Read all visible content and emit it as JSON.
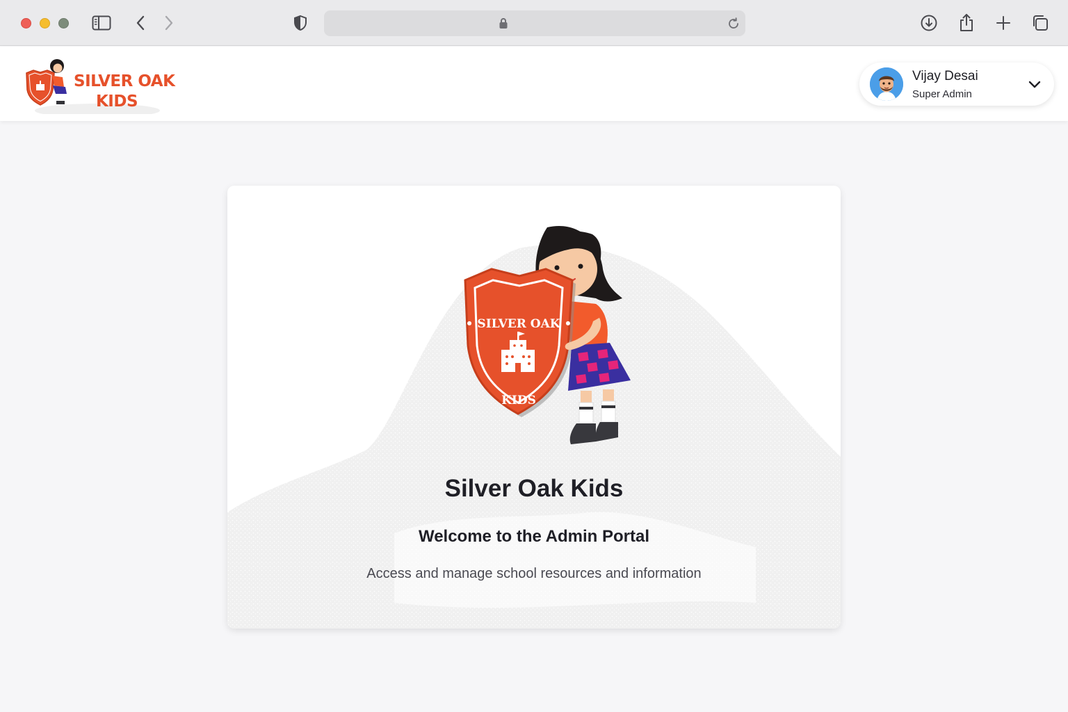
{
  "browser": {
    "url": "",
    "icons": [
      "sidebar-icon",
      "back-icon",
      "forward-icon",
      "shield-icon",
      "lock-icon",
      "reload-icon",
      "download-icon",
      "share-icon",
      "new-tab-icon",
      "tabs-overview-icon"
    ]
  },
  "header": {
    "logo_line1": "SILVER OAK",
    "logo_line2": "KIDS",
    "user": {
      "name": "Vijay Desai",
      "role": "Super Admin"
    }
  },
  "welcome": {
    "badge_top": "• SILVER OAK •",
    "badge_bottom": "KIDS",
    "title": "Silver Oak Kids",
    "subtitle": "Welcome to the Admin Portal",
    "description": "Access and manage school resources and information"
  },
  "colors": {
    "brand": "#e6512b",
    "page_bg": "#f6f6f8",
    "text_dark": "#1f1f26"
  }
}
